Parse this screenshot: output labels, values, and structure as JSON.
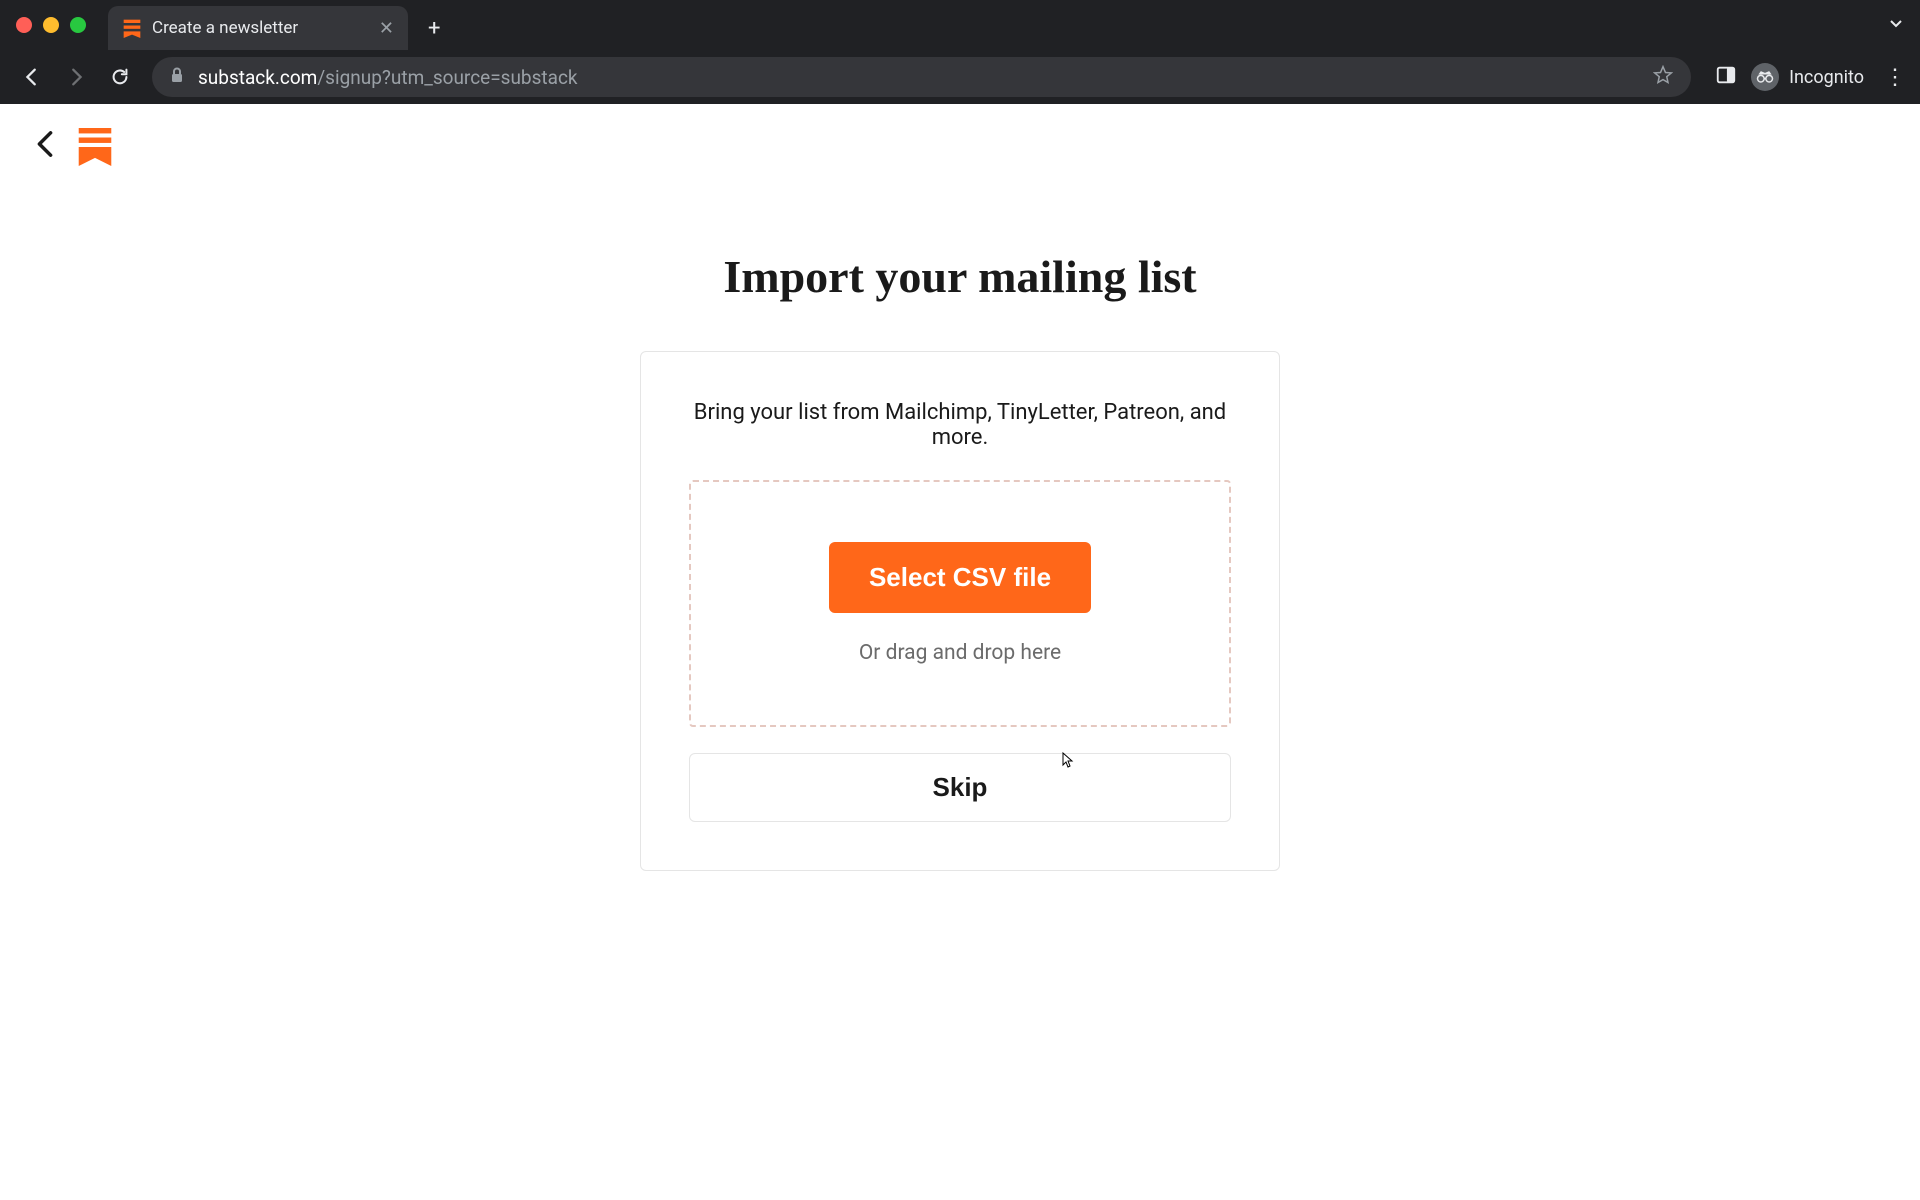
{
  "browser": {
    "tab_title": "Create a newsletter",
    "url_host": "substack.com",
    "url_path": "/signup?utm_source=substack",
    "profile_label": "Incognito"
  },
  "page": {
    "title": "Import your mailing list",
    "description": "Bring your list from Mailchimp, TinyLetter, Patreon, and more.",
    "select_button": "Select CSV file",
    "drop_hint": "Or drag and drop here",
    "skip_button": "Skip"
  },
  "colors": {
    "accent": "#ff6719"
  }
}
